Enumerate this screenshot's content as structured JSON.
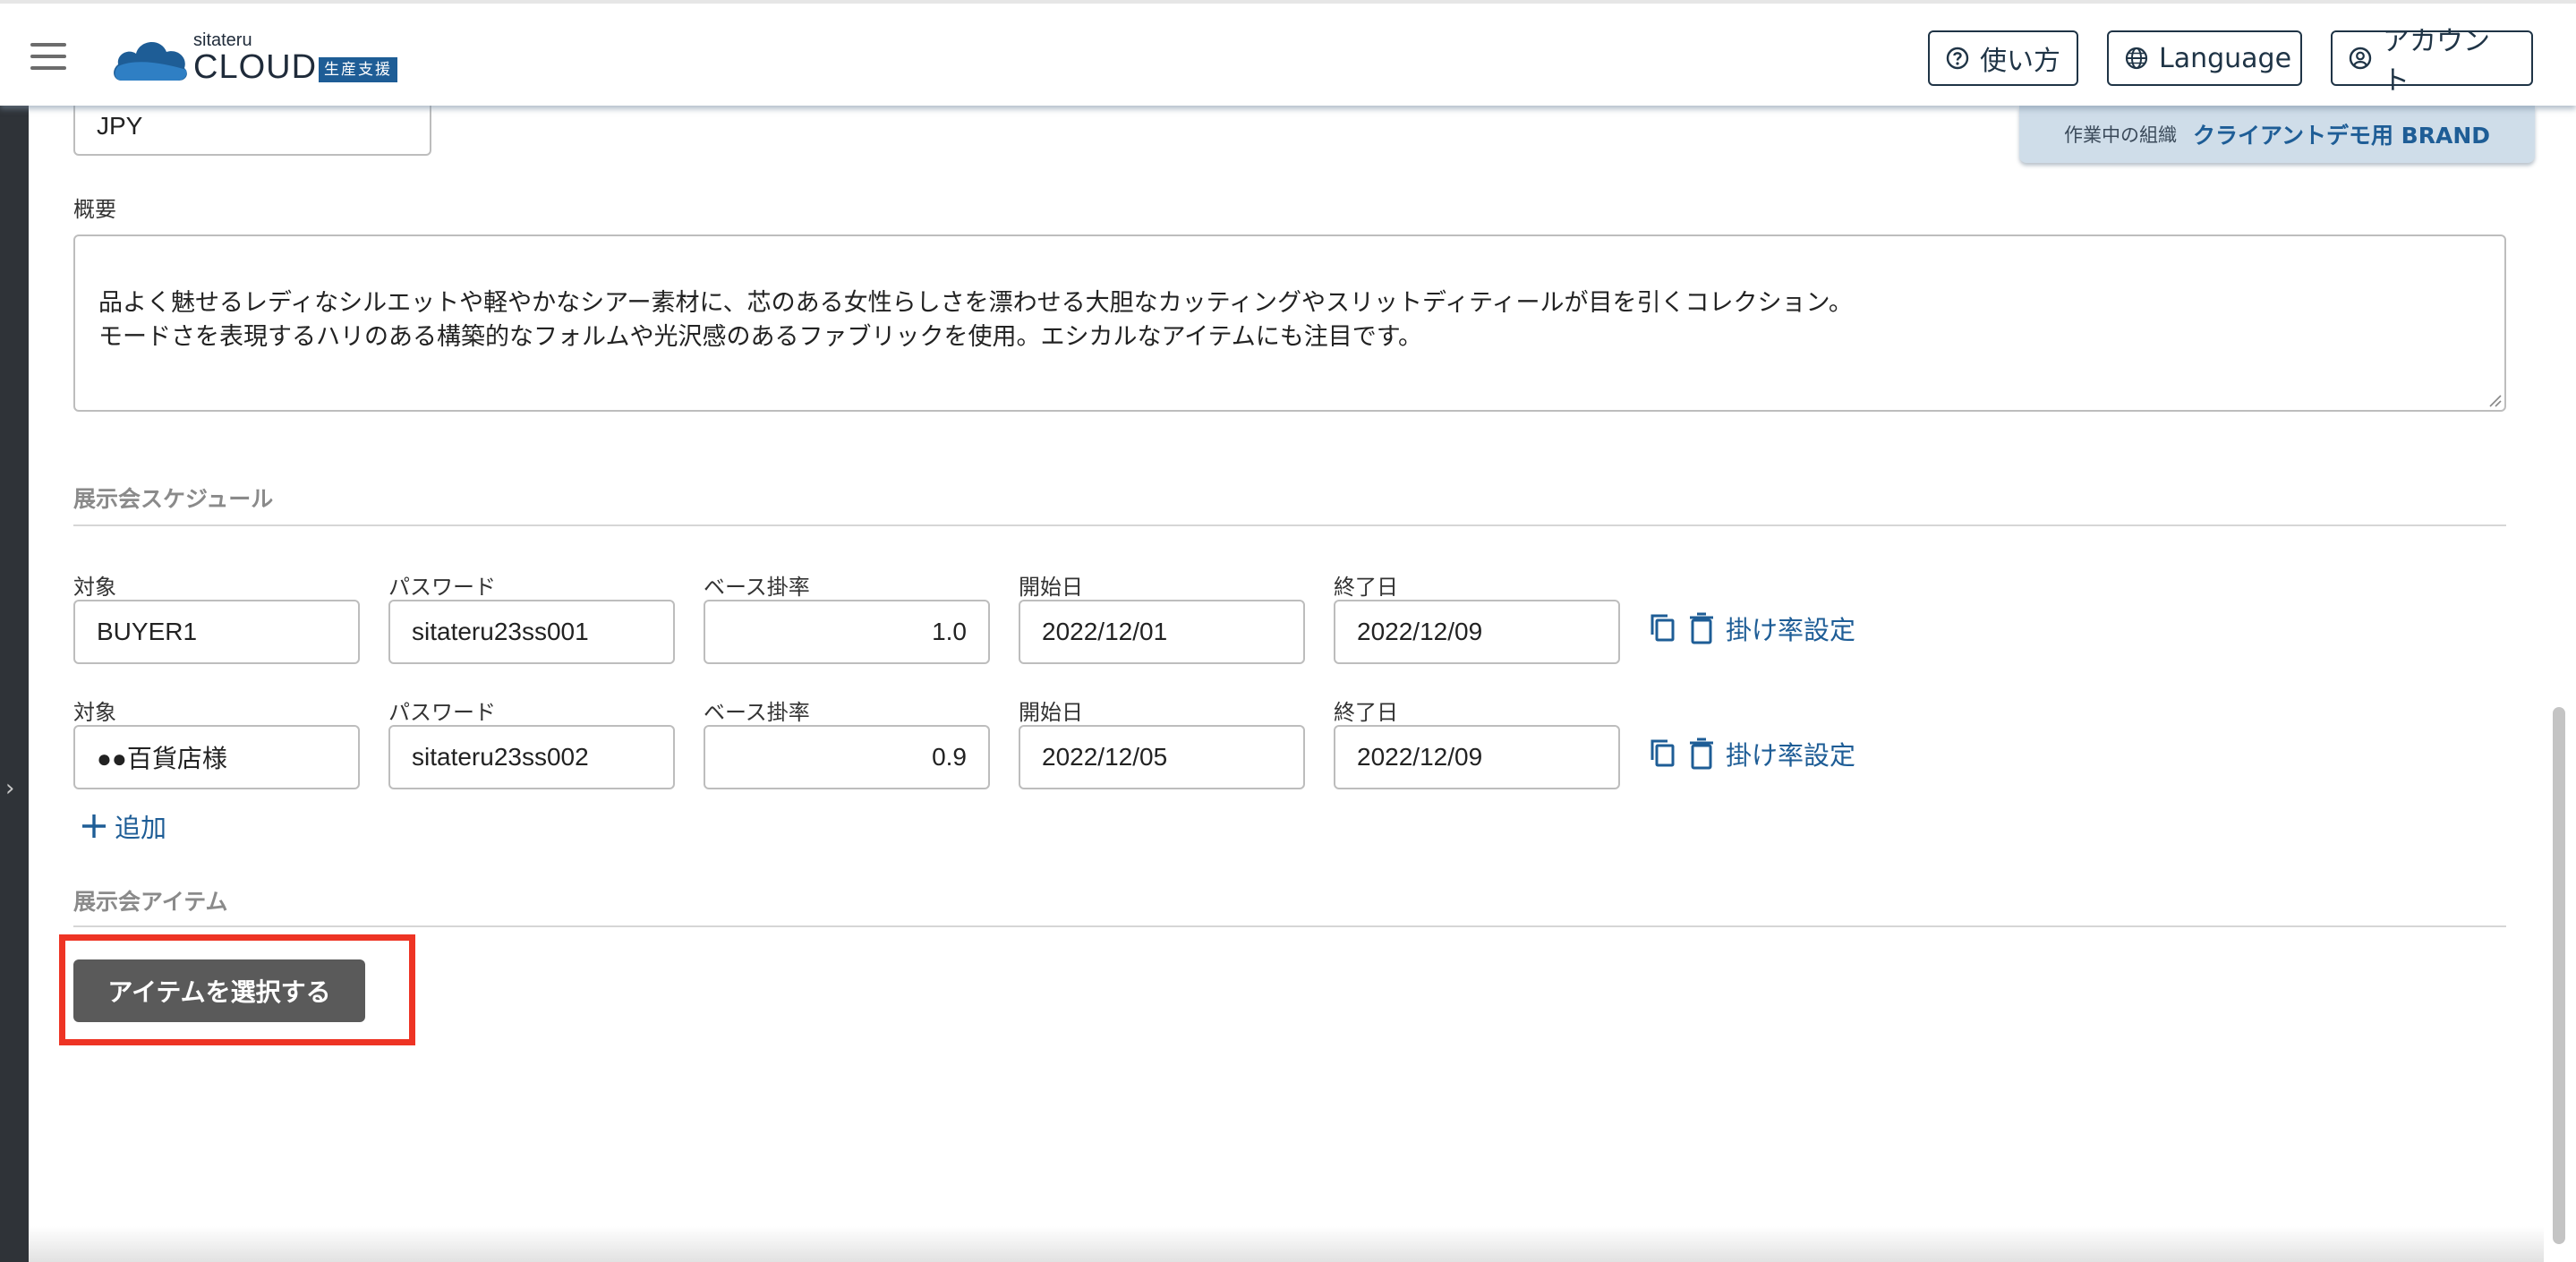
{
  "header": {
    "logo_small": "sitateru",
    "logo_big": "CLOUD",
    "logo_badge": "生産支援",
    "help_label": "使い方",
    "language_label": "Language",
    "account_label": "アカウント"
  },
  "org": {
    "label": "作業中の組織",
    "name": "クライアントデモ用 BRAND"
  },
  "form": {
    "currency_value": "JPY",
    "summary_label": "概要",
    "summary_text": "品よく魅せるレディなシルエットや軽やかなシアー素材に、芯のある女性らしさを漂わせる大胆なカッティングやスリットディティールが目を引くコレクション。\nモードさを表現するハリのある構築的なフォルムや光沢感のあるファブリックを使用。エシカルなアイテムにも注目です。"
  },
  "schedule": {
    "title": "展示会スケジュール",
    "col_target": "対象",
    "col_password": "パスワード",
    "col_rate": "ベース掛率",
    "col_start": "開始日",
    "col_end": "終了日",
    "rate_setting_label": "掛け率設定",
    "rows": [
      {
        "target": "BUYER1",
        "password": "sitateru23ss001",
        "rate": "1.0",
        "start": "2022/12/01",
        "end": "2022/12/09"
      },
      {
        "target": "●●百貨店様",
        "password": "sitateru23ss002",
        "rate": "0.9",
        "start": "2022/12/05",
        "end": "2022/12/09"
      }
    ],
    "add_label": "追加"
  },
  "items": {
    "title": "展示会アイテム",
    "select_button": "アイテムを選択する"
  },
  "colors": {
    "accent": "#1e5d96",
    "highlight": "#ee3424",
    "button": "#5a5a5a"
  }
}
